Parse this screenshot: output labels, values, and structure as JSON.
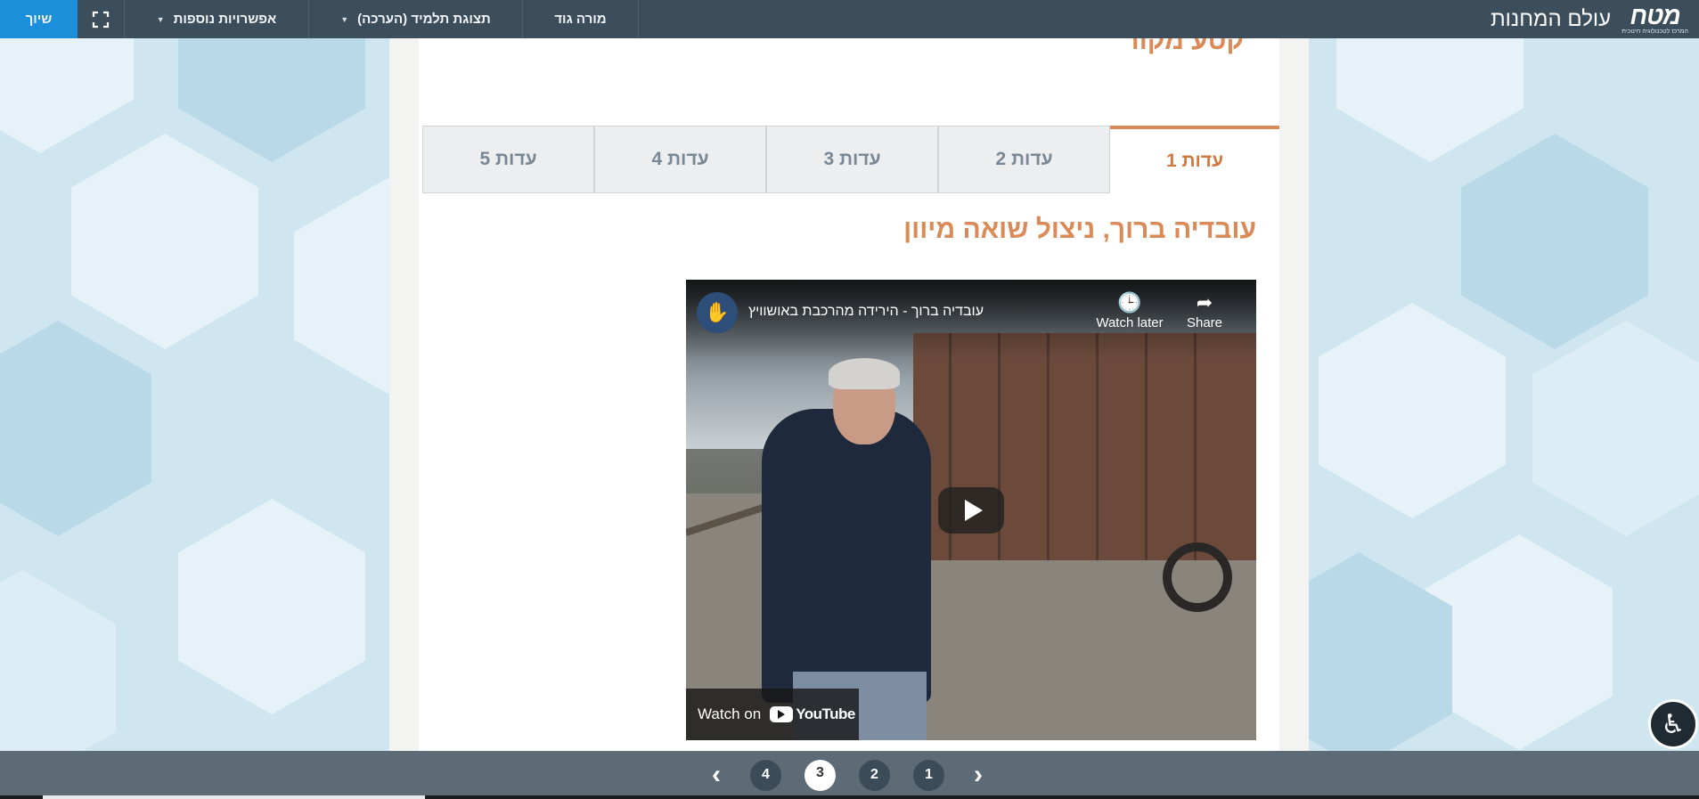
{
  "topbar": {
    "share_label": "שיוך",
    "fullscreen_icon": "fullscreen-icon",
    "more_options_label": "אפשרויות נוספות",
    "student_view_label": "תצוגת תלמיד (הערכה)",
    "teacher_label": "מורה גוד",
    "brand_title": "עולם המחנות",
    "logo_text": "מטח",
    "logo_subtext": "המרכז לטכנולוגיה חינוכית"
  },
  "content": {
    "cut_title": "קטע מקור",
    "tabs": [
      {
        "label": "עדות 1",
        "active": true
      },
      {
        "label": "עדות 2",
        "active": false
      },
      {
        "label": "עדות 3",
        "active": false
      },
      {
        "label": "עדות 4",
        "active": false
      },
      {
        "label": "עדות 5",
        "active": false
      }
    ],
    "heading": "עובדיה ברוך, ניצול שואה מיוון",
    "video": {
      "title": "עובדיה ברוך - הירידה מהרכבת באושוויץ",
      "watch_later_label": "Watch later",
      "share_label": "Share",
      "watch_on_label": "Watch on",
      "youtube_label": "YouTube"
    }
  },
  "pager": {
    "pages": [
      "4",
      "3",
      "2",
      "1"
    ],
    "current_page": "3",
    "progress_fraction": 0.225
  },
  "colors": {
    "topbar": "#3c4d5b",
    "share_button": "#1b8fd9",
    "accent": "#d98a57",
    "pager_bg": "#5d6b76"
  }
}
